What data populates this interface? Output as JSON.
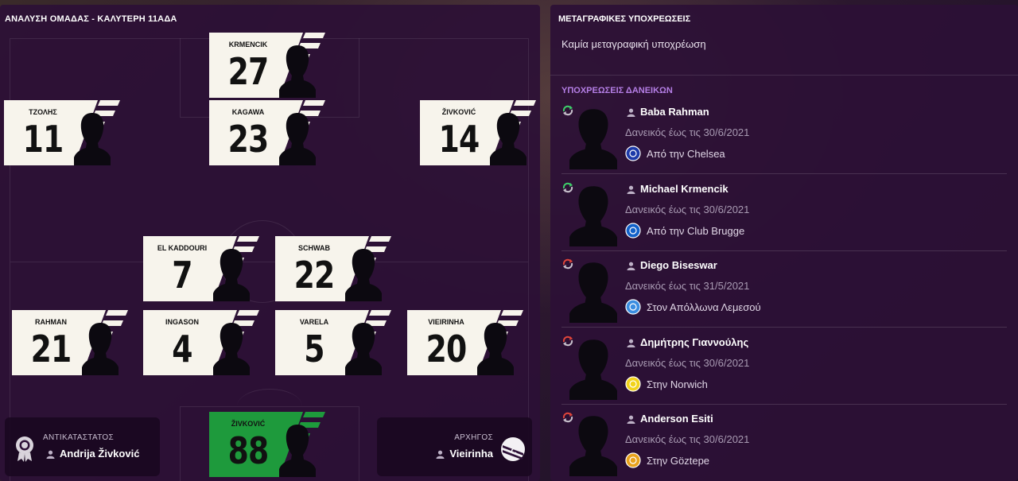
{
  "left_panel": {
    "title": "ΑΝΑΛΥΣΗ ΟΜΑΔΑΣ - ΚΑΛΥΤΕΡΗ 11ΑΔΑ",
    "players": [
      {
        "name": "KRMENCIK",
        "number": "27"
      },
      {
        "name": "ΤΖΟΛΗΣ",
        "number": "11"
      },
      {
        "name": "KAGAWA",
        "number": "23"
      },
      {
        "name": "ŽIVKOVIĆ",
        "number": "14"
      },
      {
        "name": "EL KADDOURI",
        "number": "7"
      },
      {
        "name": "SCHWAB",
        "number": "22"
      },
      {
        "name": "RAHMAN",
        "number": "21"
      },
      {
        "name": "INGASON",
        "number": "4"
      },
      {
        "name": "VARELA",
        "number": "5"
      },
      {
        "name": "VIEIRINHA",
        "number": "20"
      },
      {
        "name": "ŽIVKOVIĆ",
        "number": "88"
      }
    ],
    "vice_captain": {
      "label": "ΑΝΤΙΚΑΤΑΣΤΑΤΟΣ",
      "name": "Andrija Živković"
    },
    "captain": {
      "label": "ΑΡΧΗΓΟΣ",
      "name": "Vieirinha"
    }
  },
  "right_panel": {
    "title": "ΜΕΤΑΓΡΑΦΙΚΕΣ ΥΠΟΧΡΕΩΣΕΙΣ",
    "empty_text": "Καμία μεταγραφική υποχρέωση",
    "loans_title": "ΥΠΟΧΡΕΩΣΕΙΣ ΔΑΝΕΙΚΩΝ",
    "loans": [
      {
        "name": "Baba Rahman",
        "until": "Δανεικός έως τις 30/6/2021",
        "club": "Από την Chelsea",
        "direction": "in",
        "crest_color": "#1d3aa8"
      },
      {
        "name": "Michael Krmencik",
        "until": "Δανεικός έως τις 30/6/2021",
        "club": "Από την Club Brugge",
        "direction": "in",
        "crest_color": "#1262c9"
      },
      {
        "name": "Diego Biseswar",
        "until": "Δανεικός έως τις 31/5/2021",
        "club": "Στον Απόλλωνα Λεμεσού",
        "direction": "out",
        "crest_color": "#3b8de0"
      },
      {
        "name": "Δημήτρης Γιαννούλης",
        "until": "Δανεικός έως τις 30/6/2021",
        "club": "Στην Norwich",
        "direction": "out",
        "crest_color": "#f2d31b"
      },
      {
        "name": "Anderson Esiti",
        "until": "Δανεικός έως τις 30/6/2021",
        "club": "Στην Göztepe",
        "direction": "out",
        "crest_color": "#e8a21c"
      }
    ]
  },
  "colors": {
    "panel_bg": "#2c1036",
    "card_white": "#f7f4ec",
    "card_green": "#1e9a3c",
    "loans_title": "#b57fe6",
    "arrow_in": "#3ecf6a",
    "arrow_out": "#e0453a"
  }
}
